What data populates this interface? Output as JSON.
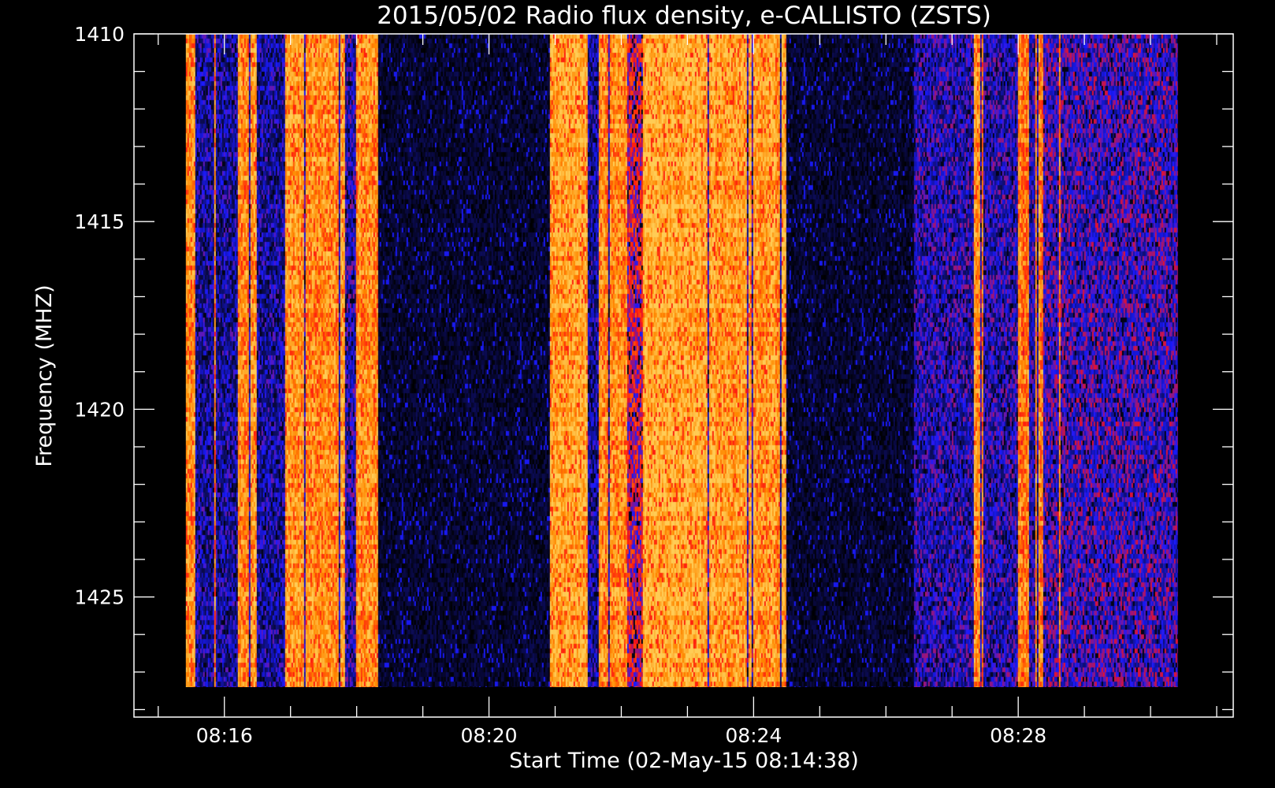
{
  "chart_data": {
    "type": "heatmap",
    "title": "2015/05/02  Radio flux density, e-CALLISTO (ZSTS)",
    "xlabel": "Start Time (02-May-15 08:14:38)",
    "ylabel": "Frequency (MHZ)",
    "x_unit": "UT",
    "xlim": [
      "08:14:38",
      "08:31:15"
    ],
    "ylim": [
      1410,
      1428.2
    ],
    "y_inverted": true,
    "data_xrange": [
      "08:15:25",
      "08:30:25"
    ],
    "data_yrange": [
      1410,
      1427.4
    ],
    "x_ticks": [
      "08:16",
      "08:20",
      "08:24",
      "08:28"
    ],
    "y_ticks": [
      "1410",
      "1415",
      "1420",
      "1425"
    ],
    "colormap": [
      "#000000",
      "#0c0c5a",
      "#1a1aff",
      "#ff1111",
      "#ff8800",
      "#ffcc55"
    ],
    "intensity_bands": [
      {
        "start": "08:15:25",
        "end": "08:15:33",
        "level": 0.85
      },
      {
        "start": "08:15:33",
        "end": "08:16:12",
        "level": 0.3
      },
      {
        "start": "08:16:12",
        "end": "08:16:30",
        "level": 0.85
      },
      {
        "start": "08:16:30",
        "end": "08:16:55",
        "level": 0.3
      },
      {
        "start": "08:16:55",
        "end": "08:17:50",
        "level": 0.85
      },
      {
        "start": "08:17:50",
        "end": "08:18:00",
        "level": 0.35
      },
      {
        "start": "08:18:00",
        "end": "08:18:20",
        "level": 0.85
      },
      {
        "start": "08:18:20",
        "end": "08:20:55",
        "level": 0.1
      },
      {
        "start": "08:20:55",
        "end": "08:21:30",
        "level": 0.9
      },
      {
        "start": "08:21:30",
        "end": "08:21:40",
        "level": 0.3
      },
      {
        "start": "08:21:40",
        "end": "08:22:05",
        "level": 0.85
      },
      {
        "start": "08:22:05",
        "end": "08:22:20",
        "level": 0.55
      },
      {
        "start": "08:22:20",
        "end": "08:23:10",
        "level": 0.92
      },
      {
        "start": "08:23:10",
        "end": "08:24:00",
        "level": 0.9
      },
      {
        "start": "08:24:00",
        "end": "08:24:30",
        "level": 0.88
      },
      {
        "start": "08:24:30",
        "end": "08:26:25",
        "level": 0.1
      },
      {
        "start": "08:26:25",
        "end": "08:27:20",
        "level": 0.35
      },
      {
        "start": "08:27:20",
        "end": "08:27:28",
        "level": 0.85
      },
      {
        "start": "08:27:28",
        "end": "08:28:00",
        "level": 0.35
      },
      {
        "start": "08:28:00",
        "end": "08:28:10",
        "level": 0.8
      },
      {
        "start": "08:28:10",
        "end": "08:28:15",
        "level": 0.35
      },
      {
        "start": "08:28:15",
        "end": "08:28:22",
        "level": 0.85
      },
      {
        "start": "08:28:22",
        "end": "08:30:25",
        "level": 0.4
      }
    ],
    "grid": false
  }
}
